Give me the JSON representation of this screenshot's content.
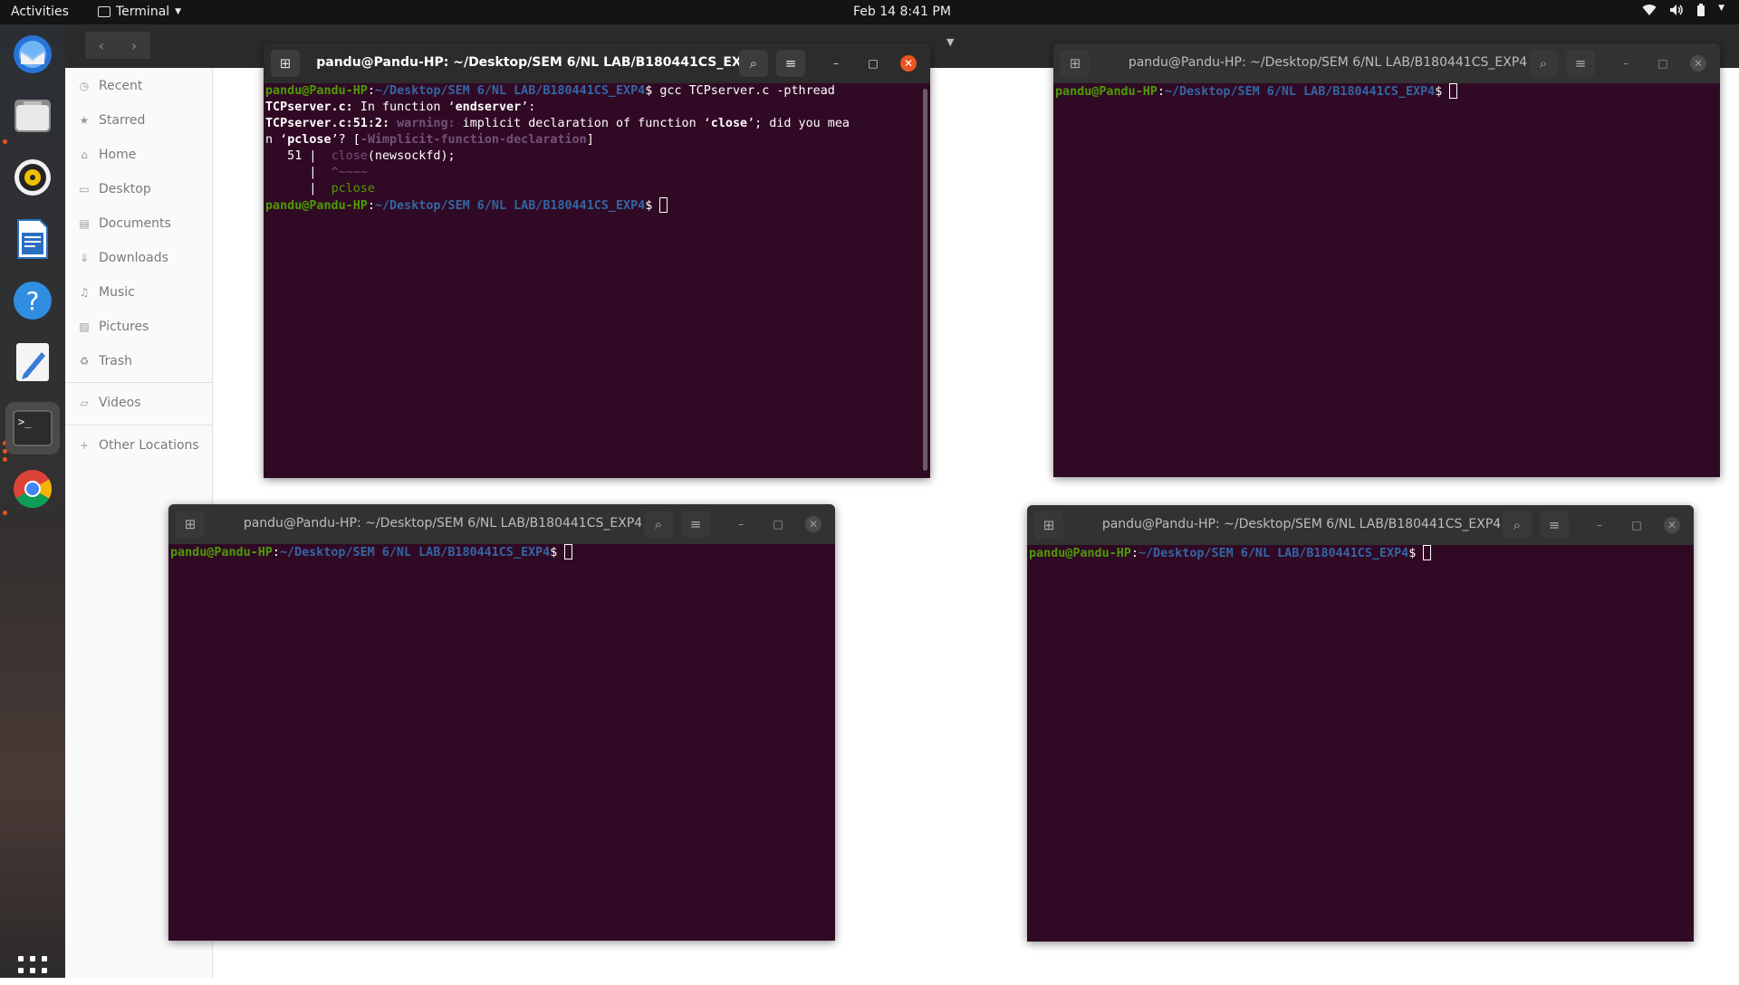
{
  "topbar": {
    "activities": "Activities",
    "app_name": "Terminal",
    "clock": "Feb 14  8:41 PM"
  },
  "files": {
    "sidebar": [
      {
        "label": "Recent",
        "icon": "clock-icon"
      },
      {
        "label": "Starred",
        "icon": "star-icon"
      },
      {
        "label": "Home",
        "icon": "home-icon"
      },
      {
        "label": "Desktop",
        "icon": "desktop-icon"
      },
      {
        "label": "Documents",
        "icon": "document-icon"
      },
      {
        "label": "Downloads",
        "icon": "download-icon"
      },
      {
        "label": "Music",
        "icon": "music-icon"
      },
      {
        "label": "Pictures",
        "icon": "picture-icon"
      },
      {
        "label": "Trash",
        "icon": "trash-icon"
      },
      {
        "label": "Videos",
        "icon": "folder-icon"
      },
      {
        "label": "Other Locations",
        "icon": "plus-icon"
      }
    ]
  },
  "terminal": {
    "title": "pandu@Pandu-HP: ~/Desktop/SEM 6/NL LAB/B180441CS_EXP4",
    "prompt_user": "pandu@Pandu-HP",
    "prompt_sep": ":",
    "prompt_path": "~/Desktop/SEM 6/NL LAB/B180441CS_EXP4",
    "prompt_end": "$ ",
    "command": "gcc TCPserver.c -pthread",
    "out": {
      "l2_file": "TCPserver.c:",
      "l2_text": " In function ‘",
      "l2_func": "endserver",
      "l2_end": "’:",
      "l3_loc": "TCPserver.c:51:2:",
      "l3_warn": " warning:",
      "l3_text": " implicit declaration of function ‘",
      "l3_func": "close",
      "l3_tail": "’; did you mea",
      "l4_head": "n ‘",
      "l4_func": "pclose",
      "l4_mid": "’? [",
      "l4_flag": "-Wimplicit-function-declaration",
      "l4_end": "]",
      "l5_gutter": "   51 |  ",
      "l5_call": "close",
      "l5_args": "(newsockfd);",
      "l6_gutter": "      |  ",
      "l6_marks": "^~~~~",
      "l7_gutter": "      |  ",
      "l7_fix": "pclose"
    }
  }
}
